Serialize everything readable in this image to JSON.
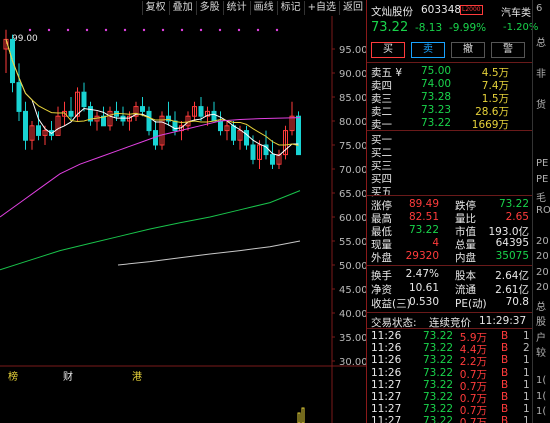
{
  "toolbar": {
    "items": [
      "复权",
      "叠加",
      "多股",
      "统计",
      "画线",
      "标记",
      "+自选",
      "返回"
    ]
  },
  "chart": {
    "peak_label": "99.00",
    "y_axis": [
      "95.00",
      "90.00",
      "85.00",
      "80.00",
      "75.00",
      "70.00",
      "65.00",
      "60.00",
      "55.00",
      "50.00",
      "45.00",
      "40.00",
      "35.00",
      "30.00"
    ],
    "markers": [
      "榜",
      "财",
      "港"
    ],
    "colors": {
      "up": "#ff3b3b",
      "down": "#19d3d3",
      "ma5": "#ffffff",
      "ma10": "#e6d23a",
      "ma20": "#e040e0",
      "ma60": "#19c34b",
      "ma120": "#c8c8c8"
    },
    "candles": [
      [
        95,
        99,
        90,
        97
      ],
      [
        97,
        98,
        86,
        88
      ],
      [
        88,
        92,
        80,
        82
      ],
      [
        82,
        84,
        74,
        76
      ],
      [
        76,
        80,
        74,
        79
      ],
      [
        79,
        82,
        76,
        77
      ],
      [
        77,
        79,
        75,
        78
      ],
      [
        78,
        80,
        76,
        77
      ],
      [
        77,
        83,
        77,
        81
      ],
      [
        81,
        84,
        79,
        82
      ],
      [
        82,
        85,
        80,
        81
      ],
      [
        81,
        87,
        80,
        86
      ],
      [
        86,
        88,
        82,
        83
      ],
      [
        83,
        84,
        79,
        80
      ],
      [
        80,
        82,
        78,
        81
      ],
      [
        81,
        83,
        79,
        79
      ],
      [
        79,
        83,
        78,
        82
      ],
      [
        82,
        84,
        80,
        81
      ],
      [
        81,
        83,
        79,
        80
      ],
      [
        80,
        82,
        78,
        81
      ],
      [
        81,
        84,
        80,
        83
      ],
      [
        83,
        85,
        81,
        82
      ],
      [
        82,
        83,
        77,
        78
      ],
      [
        78,
        80,
        74,
        75
      ],
      [
        75,
        82,
        74,
        81
      ],
      [
        81,
        84,
        79,
        80
      ],
      [
        80,
        82,
        77,
        78
      ],
      [
        78,
        80,
        76,
        79
      ],
      [
        79,
        82,
        78,
        81
      ],
      [
        81,
        84,
        80,
        83
      ],
      [
        83,
        85,
        80,
        81
      ],
      [
        81,
        83,
        79,
        82
      ],
      [
        82,
        84,
        80,
        80
      ],
      [
        80,
        82,
        77,
        78
      ],
      [
        78,
        80,
        76,
        79
      ],
      [
        79,
        80,
        75,
        76
      ],
      [
        76,
        79,
        74,
        78
      ],
      [
        78,
        79,
        74,
        75
      ],
      [
        75,
        77,
        71,
        72
      ],
      [
        72,
        76,
        70,
        75
      ],
      [
        75,
        78,
        72,
        73
      ],
      [
        73,
        76,
        70,
        71
      ],
      [
        71,
        74,
        70,
        73
      ],
      [
        73,
        79,
        72,
        78
      ],
      [
        78,
        84,
        77,
        81
      ],
      [
        81,
        82,
        73,
        73
      ]
    ]
  },
  "quote": {
    "name": "文灿股份",
    "code": "603348",
    "tag": "L2000",
    "price": "73.22",
    "change": "-8.13",
    "pct": "-9.99%",
    "sector": "汽车类",
    "sector_pct": "-1.20%",
    "buttons": [
      "买",
      "卖",
      "撤",
      "警"
    ],
    "asks": [
      {
        "label": "卖五 ¥",
        "price": "75.00",
        "vol": "4.5万"
      },
      {
        "label": "卖四",
        "price": "74.00",
        "vol": "7.4万"
      },
      {
        "label": "卖三",
        "price": "73.28",
        "vol": "1.5万"
      },
      {
        "label": "卖二",
        "price": "73.23",
        "vol": "28.6万"
      },
      {
        "label": "卖一",
        "price": "73.22",
        "vol": "1669万"
      }
    ],
    "bids": [
      "买一",
      "买二",
      "买三",
      "买四",
      "买五"
    ],
    "stats": [
      {
        "l1": "涨停",
        "v1": "89.49",
        "c1": "red",
        "l2": "跌停",
        "v2": "73.22",
        "c2": "grn"
      },
      {
        "l1": "最高",
        "v1": "82.51",
        "c1": "red",
        "l2": "量比",
        "v2": "2.65",
        "c2": "red"
      },
      {
        "l1": "最低",
        "v1": "73.22",
        "c1": "grn",
        "l2": "市值",
        "v2": "193.0亿",
        "c2": "white"
      },
      {
        "l1": "现量",
        "v1": "4",
        "c1": "red",
        "l2": "总量",
        "v2": "64395",
        "c2": "white"
      },
      {
        "l1": "外盘",
        "v1": "29320",
        "c1": "red",
        "l2": "内盘",
        "v2": "35075",
        "c2": "grn"
      }
    ],
    "stats2": [
      {
        "l1": "换手",
        "v1": "2.47%",
        "l2": "股本",
        "v2": "2.64亿"
      },
      {
        "l1": "净资",
        "v1": "10.61",
        "l2": "流通",
        "v2": "2.61亿"
      },
      {
        "l1": "收益(三)",
        "v1": "0.530",
        "l2": "PE(动)",
        "v2": "70.8"
      }
    ],
    "status_label": "交易状态:",
    "status_value": "连续竞价",
    "status_time": "11:29:37",
    "trades": [
      {
        "t": "11:26",
        "p": "73.22",
        "v": "5.9万",
        "s": "B",
        "n": "1"
      },
      {
        "t": "11:26",
        "p": "73.22",
        "v": "4.4万",
        "s": "B",
        "n": "2"
      },
      {
        "t": "11:26",
        "p": "73.22",
        "v": "2.2万",
        "s": "B",
        "n": "1"
      },
      {
        "t": "11:26",
        "p": "73.22",
        "v": "0.7万",
        "s": "B",
        "n": "1"
      },
      {
        "t": "11:27",
        "p": "73.22",
        "v": "0.7万",
        "s": "B",
        "n": "1"
      },
      {
        "t": "11:27",
        "p": "73.22",
        "v": "0.7万",
        "s": "B",
        "n": "1"
      },
      {
        "t": "11:27",
        "p": "73.22",
        "v": "0.7万",
        "s": "B",
        "n": "1"
      },
      {
        "t": "11:27",
        "p": "73.22",
        "v": "0.7万",
        "s": "B",
        "n": "1"
      }
    ]
  },
  "farright": {
    "items": [
      "6",
      "",
      "总",
      "",
      "非",
      "",
      "货",
      "",
      "",
      "",
      "PE",
      "PE",
      "毛",
      "RO",
      "",
      "20",
      "20",
      "20",
      "20",
      "总",
      "股",
      "户",
      "较",
      "",
      "1(",
      "1(",
      "1("
    ]
  }
}
